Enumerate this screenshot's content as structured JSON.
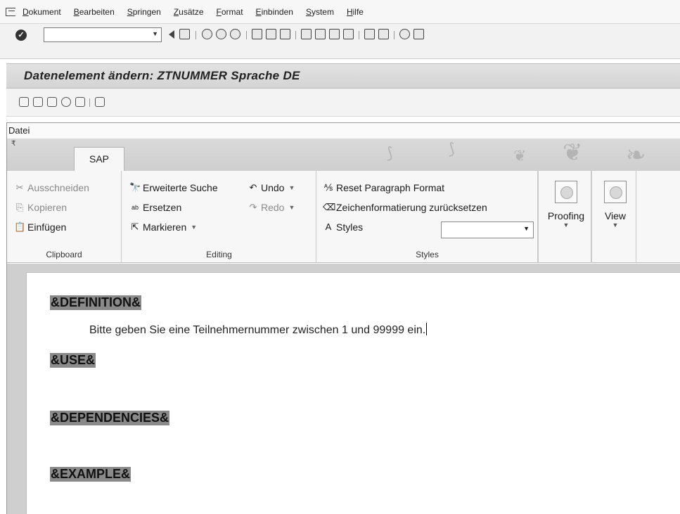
{
  "menubar": {
    "items": [
      "Dokument",
      "Bearbeiten",
      "Springen",
      "Zusätze",
      "Format",
      "Einbinden",
      "System",
      "Hilfe"
    ]
  },
  "toolbar": {
    "command_value": "",
    "icons": [
      "enter-icon",
      "back-icon",
      "save-icon",
      "nav-back-icon",
      "exit-icon",
      "cancel-icon",
      "print-icon",
      "find-icon",
      "find-next-icon",
      "first-page-icon",
      "prev-page-icon",
      "next-page-icon",
      "last-page-icon",
      "new-session-icon",
      "shortcut-icon",
      "help-icon",
      "layout-icon"
    ]
  },
  "title": "Datenelement ändern: ZTNUMMER Sprache DE",
  "editor": {
    "file_menu": "Datei",
    "tab": "SAP",
    "clipboard": {
      "label": "Clipboard",
      "cut": "Ausschneiden",
      "copy": "Kopieren",
      "paste": "Einfügen"
    },
    "editing": {
      "label": "Editing",
      "advanced_search": "Erweiterte Suche",
      "replace": "Ersetzen",
      "select": "Markieren",
      "undo": "Undo",
      "redo": "Redo"
    },
    "styles": {
      "label": "Styles",
      "reset_paragraph": "Reset Paragraph Format",
      "reset_char": "Zeichenformatierung zurücksetzen",
      "styles": "Styles",
      "style_value": ""
    },
    "proofing": "Proofing",
    "view": "View"
  },
  "document": {
    "definition": "&DEFINITION&",
    "body": "Bitte geben Sie eine Teilnehmernummer zwischen 1 und 99999 ein.",
    "use": "&USE&",
    "dependencies": "&DEPENDENCIES&",
    "example": "&EXAMPLE&"
  },
  "colors": {
    "title_bg": "#d8d8d8",
    "heading_highlight": "#8a8a8a",
    "ribbon_bg": "#f7f7f7"
  }
}
